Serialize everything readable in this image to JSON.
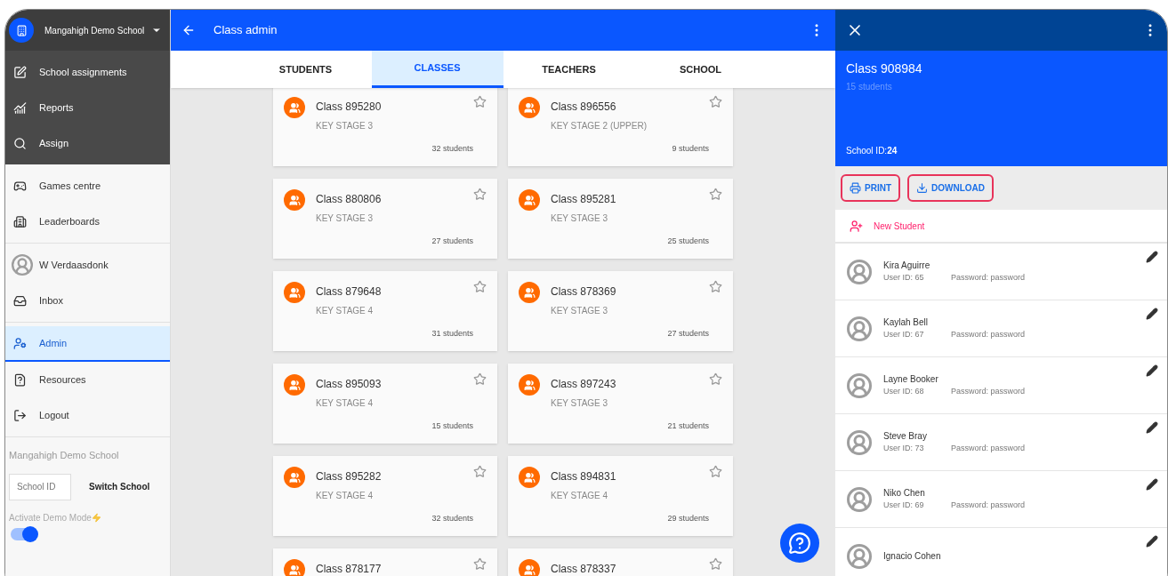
{
  "sidebar": {
    "school_menu": {
      "label": "Mangahigh Demo School"
    },
    "sections": [
      {
        "dark": true,
        "items": [
          {
            "label": "School assignments",
            "selected": false
          },
          {
            "label": "Reports",
            "selected": false
          },
          {
            "label": "Assign",
            "selected": false
          }
        ]
      },
      {
        "dark": false,
        "items": [
          {
            "label": "Games centre",
            "selected": false
          },
          {
            "label": "Leaderboards",
            "selected": false
          }
        ]
      },
      {
        "dark": false,
        "items": [
          {
            "label": "W Verdaasdonk",
            "selected": false
          },
          {
            "label": "Inbox",
            "selected": false
          }
        ]
      },
      {
        "dark": false,
        "items": [
          {
            "label": "Admin",
            "selected": true
          },
          {
            "label": "Resources",
            "selected": false
          },
          {
            "label": "Logout",
            "selected": false
          }
        ]
      }
    ],
    "footer": {
      "school_name": "Mangahigh Demo School",
      "school_id_field": {
        "placeholder": "School ID"
      },
      "switch_button": "Switch School",
      "demo_mode": {
        "label": "Activate Demo Mode",
        "on": true
      }
    }
  },
  "app_bar": {
    "title": "Class admin"
  },
  "tabs": [
    {
      "label": "STUDENTS",
      "selected": false
    },
    {
      "label": "CLASSES",
      "selected": true
    },
    {
      "label": "TEACHERS",
      "selected": false
    },
    {
      "label": "SCHOOL",
      "selected": false
    }
  ],
  "classes": [
    {
      "name": "Class 895280",
      "stage": "KEY STAGE 3",
      "students": "32 students",
      "starred": false
    },
    {
      "name": "Class 896556",
      "stage": "KEY STAGE 2 (UPPER)",
      "students": "9 students",
      "starred": false
    },
    {
      "name": "Class 880806",
      "stage": "KEY STAGE 3",
      "students": "27 students",
      "starred": false
    },
    {
      "name": "Class 895281",
      "stage": "KEY STAGE 3",
      "students": "25 students",
      "starred": false
    },
    {
      "name": "Class 879648",
      "stage": "KEY STAGE 4",
      "students": "31 students",
      "starred": false
    },
    {
      "name": "Class 878369",
      "stage": "KEY STAGE 3",
      "students": "27 students",
      "starred": false
    },
    {
      "name": "Class 895093",
      "stage": "KEY STAGE 4",
      "students": "15 students",
      "starred": false
    },
    {
      "name": "Class 897243",
      "stage": "KEY STAGE 3",
      "students": "21 students",
      "starred": false
    },
    {
      "name": "Class 895282",
      "stage": "KEY STAGE 4",
      "students": "32 students",
      "starred": false
    },
    {
      "name": "Class 894831",
      "stage": "KEY STAGE 4",
      "students": "29 students",
      "starred": false
    },
    {
      "name": "Class 878177",
      "starred": false
    },
    {
      "name": "Class 878337",
      "starred": false
    }
  ],
  "class_panel": {
    "title": "Class 908984",
    "subtitle": "15 students",
    "school_id": "School ID:**24**",
    "actions": [
      {
        "label": "PRINT",
        "highlighted": true
      },
      {
        "label": "DOWNLOAD",
        "highlighted": true
      }
    ],
    "new_student": "New Student",
    "students": [
      {
        "name": "Kira Aguirre",
        "user_id": "User ID: 65",
        "password": "Password: password"
      },
      {
        "name": "Kaylah Bell",
        "user_id": "User ID: 67",
        "password": "Password: password"
      },
      {
        "name": "Layne Booker",
        "user_id": "User ID: 68",
        "password": "Password: password"
      },
      {
        "name": "Steve Bray",
        "user_id": "User ID: 73",
        "password": "Password: password"
      },
      {
        "name": "Niko Chen",
        "user_id": "User ID: 69",
        "password": "Password: password"
      },
      {
        "name": "Ignacio Cohen"
      }
    ]
  }
}
